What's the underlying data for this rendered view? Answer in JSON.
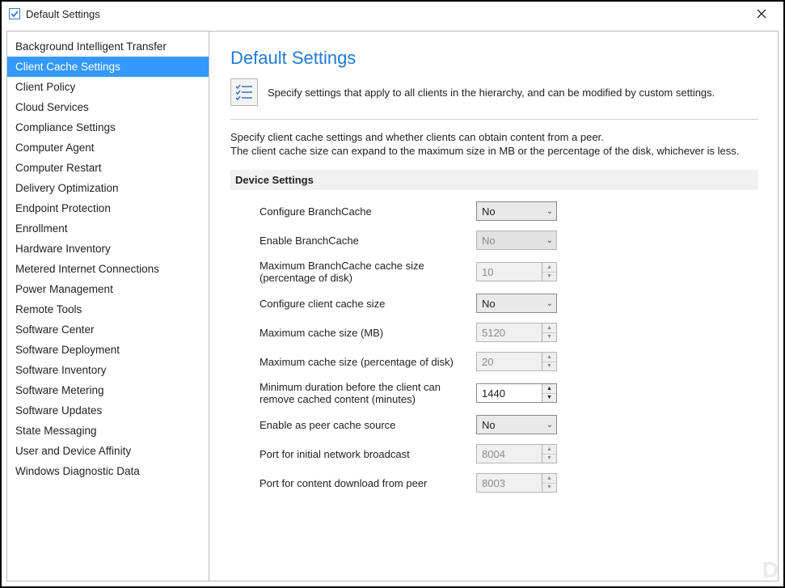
{
  "window": {
    "title": "Default Settings"
  },
  "sidebar": {
    "items": [
      {
        "label": "Background Intelligent Transfer"
      },
      {
        "label": "Client Cache Settings"
      },
      {
        "label": "Client Policy"
      },
      {
        "label": "Cloud Services"
      },
      {
        "label": "Compliance Settings"
      },
      {
        "label": "Computer Agent"
      },
      {
        "label": "Computer Restart"
      },
      {
        "label": "Delivery Optimization"
      },
      {
        "label": "Endpoint Protection"
      },
      {
        "label": "Enrollment"
      },
      {
        "label": "Hardware Inventory"
      },
      {
        "label": "Metered Internet Connections"
      },
      {
        "label": "Power Management"
      },
      {
        "label": "Remote Tools"
      },
      {
        "label": "Software Center"
      },
      {
        "label": "Software Deployment"
      },
      {
        "label": "Software Inventory"
      },
      {
        "label": "Software Metering"
      },
      {
        "label": "Software Updates"
      },
      {
        "label": "State Messaging"
      },
      {
        "label": "User and Device Affinity"
      },
      {
        "label": "Windows Diagnostic Data"
      }
    ],
    "selected_index": 1
  },
  "main": {
    "heading": "Default Settings",
    "intro": "Specify settings that apply to all clients in the hierarchy, and can be modified by custom settings.",
    "desc_line1": "Specify client cache settings and whether clients can obtain content from a peer.",
    "desc_line2": "The client cache size can expand to the maximum size in MB or the percentage of the disk, whichever is less.",
    "section_header": "Device Settings",
    "rows": [
      {
        "label": "Configure BranchCache",
        "type": "select",
        "value": "No",
        "enabled": true
      },
      {
        "label": "Enable BranchCache",
        "type": "select",
        "value": "No",
        "enabled": false
      },
      {
        "label": "Maximum BranchCache cache size (percentage of disk)",
        "type": "spinner",
        "value": "10",
        "enabled": false
      },
      {
        "label": "Configure client cache size",
        "type": "select",
        "value": "No",
        "enabled": true
      },
      {
        "label": "Maximum cache size (MB)",
        "type": "spinner",
        "value": "5120",
        "enabled": false
      },
      {
        "label": "Maximum cache size (percentage of disk)",
        "type": "spinner",
        "value": "20",
        "enabled": false
      },
      {
        "label": "Minimum duration before the client can remove cached content (minutes)",
        "type": "spinner",
        "value": "1440",
        "enabled": true
      },
      {
        "label": "Enable as peer cache source",
        "type": "select",
        "value": "No",
        "enabled": true
      },
      {
        "label": "Port for initial network broadcast",
        "type": "spinner",
        "value": "8004",
        "enabled": false
      },
      {
        "label": "Port for content download from peer",
        "type": "spinner",
        "value": "8003",
        "enabled": false
      }
    ]
  }
}
